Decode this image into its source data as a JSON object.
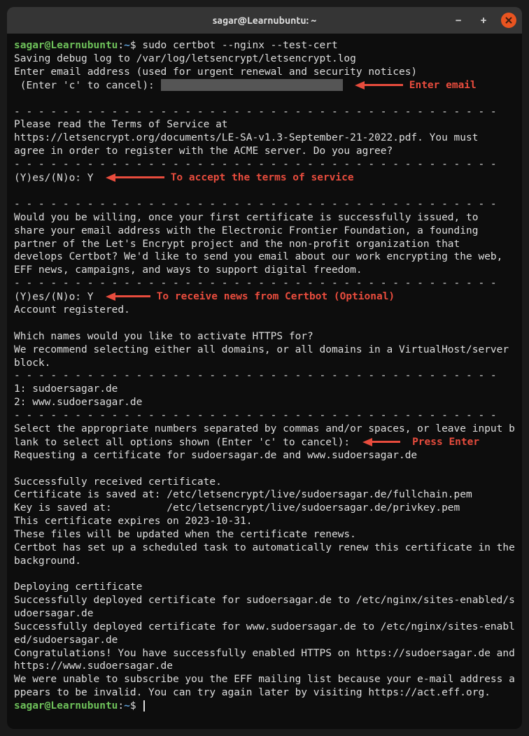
{
  "window": {
    "title": "sagar@Learnubuntu: ~"
  },
  "prompt": {
    "user_host": "sagar@Learnubuntu",
    "path": "~",
    "dollar": "$"
  },
  "command": "sudo certbot --nginx --test-cert",
  "output": {
    "l1": "Saving debug log to /var/log/letsencrypt/letsencrypt.log",
    "l2": "Enter email address (used for urgent renewal and security notices)",
    "l3": " (Enter 'c' to cancel): ",
    "sep": "- - - - - - - - - - - - - - - - - - - - - - - - - - - - - - - - - - - - - - - -",
    "tos1": "Please read the Terms of Service at",
    "tos2": "https://letsencrypt.org/documents/LE-SA-v1.3-September-21-2022.pdf. You must",
    "tos3": "agree in order to register with the ACME server. Do you agree?",
    "yn1": "(Y)es/(N)o: Y",
    "eff1": "Would you be willing, once your first certificate is successfully issued, to",
    "eff2": "share your email address with the Electronic Frontier Foundation, a founding",
    "eff3": "partner of the Let's Encrypt project and the non-profit organization that",
    "eff4": "develops Certbot? We'd like to send you email about our work encrypting the web,",
    "eff5": "EFF news, campaigns, and ways to support digital freedom.",
    "yn2": "(Y)es/(N)o: Y",
    "reg": "Account registered.",
    "which": "Which names would you like to activate HTTPS for?",
    "rec": "We recommend selecting either all domains, or all domains in a VirtualHost/server block.",
    "d1": "1: sudoersagar.de",
    "d2": "2: www.sudoersagar.de",
    "sel": "Select the appropriate numbers separated by commas and/or spaces, or leave input ",
    "sel2": "blank to select all options shown (Enter 'c' to cancel): ",
    "req": "Requesting a certificate for sudoersagar.de and www.sudoersagar.de",
    "suc": "Successfully received certificate.",
    "cert": "Certificate is saved at: /etc/letsencrypt/live/sudoersagar.de/fullchain.pem",
    "key": "Key is saved at:         /etc/letsencrypt/live/sudoersagar.de/privkey.pem",
    "exp": "This certificate expires on 2023-10-31.",
    "upd": "These files will be updated when the certificate renews.",
    "sched": "Certbot has set up a scheduled task to automatically renew this certificate in the background.",
    "dep": "Deploying certificate",
    "dep1": "Successfully deployed certificate for sudoersagar.de to /etc/nginx/sites-enabled/sudoersagar.de",
    "dep2": "Successfully deployed certificate for www.sudoersagar.de to /etc/nginx/sites-enabled/sudoersagar.de",
    "cong": "Congratulations! You have successfully enabled HTTPS on https://sudoersagar.de and https://www.sudoersagar.de",
    "unable": "We were unable to subscribe you the EFF mailing list because your e-mail address appears to be invalid. You can try again later by visiting https://act.eff.org."
  },
  "annotations": {
    "email": "Enter email",
    "tos": "To accept the terms of service",
    "news": "To receive news from Certbot (Optional)",
    "enter": "Press Enter"
  }
}
